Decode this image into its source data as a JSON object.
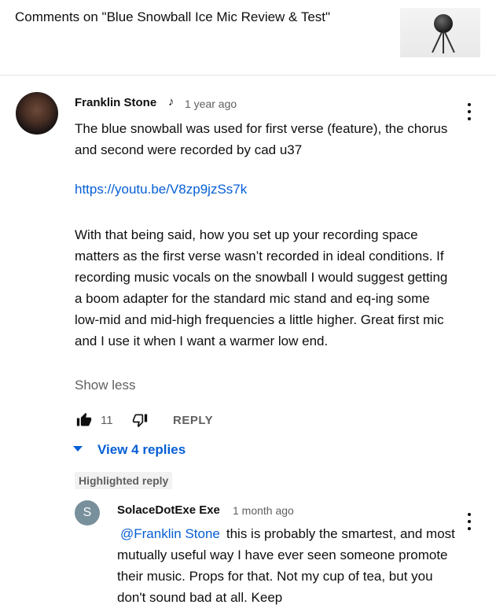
{
  "header": {
    "title": "Comments on \"Blue Snowball Ice Mic Review & Test\""
  },
  "comment": {
    "author": "Franklin Stone",
    "note_glyph": "♪",
    "time": "1 year ago",
    "paragraph1": "The blue snowball was used for first verse (feature), the chorus and second were recorded by cad u37",
    "link": "https://youtu.be/V8zp9jzSs7k",
    "paragraph2": "With that being said, how you set up your recording space matters as the first verse wasn’t recorded in ideal conditions. If recording music vocals on the snowball I would suggest getting a boom adapter for the standard mic stand and eq-ing some low-mid and mid-high frequencies a little higher. Great first mic and I use it when I want a warmer low end.",
    "show_less": "Show less",
    "like_count": "11",
    "reply_label": "REPLY",
    "view_replies": "View 4 replies"
  },
  "reply": {
    "badge": "Highlighted reply",
    "avatar_letter": "S",
    "author": "SolaceDotExe Exe",
    "time": "1 month ago",
    "mention": "@Franklin Stone",
    "text": "this is probably the smartest, and most mutually useful way I have ever seen someone promote their music. Props for that. Not my cup of tea, but you don't sound bad at all. Keep"
  },
  "colors": {
    "link": "#065fd4",
    "secondary_text": "#606060",
    "reply_avatar": "#78909c"
  },
  "icons": {
    "like": "thumb-up-icon",
    "dislike": "thumb-down-icon",
    "menu": "more-vert-icon",
    "expand": "triangle-down-icon"
  }
}
